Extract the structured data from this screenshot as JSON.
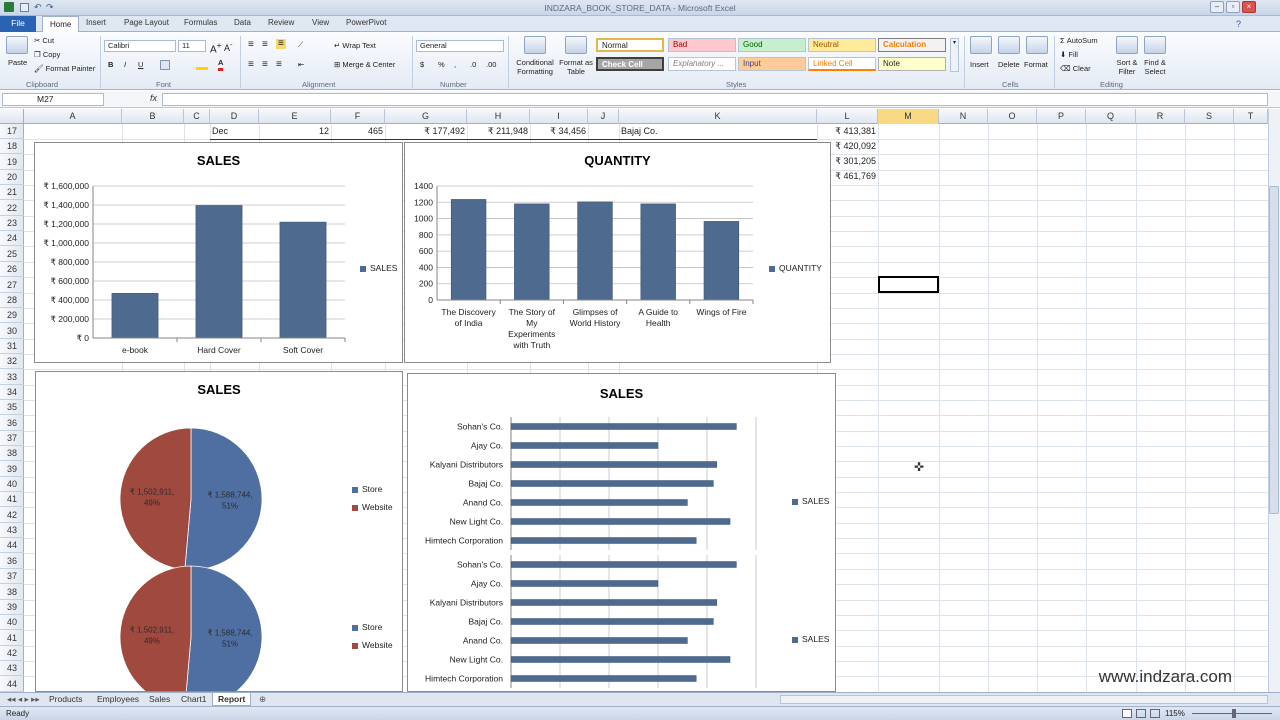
{
  "window": {
    "title": "INDZARA_BOOK_STORE_DATA - Microsoft Excel"
  },
  "tabs": [
    "File",
    "Home",
    "Insert",
    "Page Layout",
    "Formulas",
    "Data",
    "Review",
    "View",
    "PowerPivot"
  ],
  "ribbon": {
    "clipboard": {
      "paste": "Paste",
      "cut": "Cut",
      "copy": "Copy",
      "format_painter": "Format Painter",
      "label": "Clipboard"
    },
    "font": {
      "name": "Calibri",
      "size": "11",
      "bold": "B",
      "italic": "I",
      "underline": "U",
      "label": "Font"
    },
    "alignment": {
      "wrap": "Wrap Text",
      "merge": "Merge & Center",
      "label": "Alignment"
    },
    "number": {
      "format": "General",
      "currency": "$",
      "percent": "%",
      "label": "Number"
    },
    "styles": {
      "conditional": "Conditional Formatting",
      "format_table": "Format as Table",
      "cells": [
        "Normal",
        "Bad",
        "Good",
        "Neutral",
        "Calculation",
        "Check Cell",
        "Explanatory ...",
        "Input",
        "Linked Cell",
        "Note"
      ],
      "label": "Styles"
    },
    "cells": {
      "insert": "Insert",
      "delete": "Delete",
      "format": "Format",
      "label": "Cells"
    },
    "editing": {
      "autosum": "AutoSum",
      "fill": "Fill",
      "clear": "Clear",
      "sort": "Sort & Filter",
      "find": "Find & Select",
      "label": "Editing"
    }
  },
  "formula_bar": {
    "name_box": "M27",
    "fx": "fx",
    "value": ""
  },
  "columns": [
    "A",
    "B",
    "C",
    "D",
    "E",
    "F",
    "G",
    "H",
    "I",
    "J",
    "K",
    "L",
    "M",
    "N",
    "O",
    "P",
    "Q",
    "R",
    "S",
    "T"
  ],
  "row_labels": [
    "17",
    "18",
    "19",
    "20",
    "21",
    "22",
    "23",
    "24",
    "25",
    "26",
    "27",
    "28",
    "29",
    "30",
    "31",
    "32",
    "33",
    "34",
    "35",
    "36",
    "37",
    "38",
    "39",
    "40",
    "41",
    "42",
    "43",
    "44",
    "36",
    "37",
    "38",
    "39",
    "40",
    "41",
    "42",
    "43",
    "44"
  ],
  "grid_cells": {
    "row17": {
      "month": "Dec",
      "e": "12",
      "f": "465",
      "g": "₹ 177,492",
      "h": "₹ 211,948",
      "i": "₹ 34,456",
      "k": "Bajaj Co.",
      "l": "₹ 413,381"
    },
    "l18": "₹ 420,092",
    "l19": "₹ 301,205",
    "l20": "₹ 461,769"
  },
  "chart_data": [
    {
      "type": "bar",
      "title": "SALES",
      "categories": [
        "e-book",
        "Hard Cover",
        "Soft Cover"
      ],
      "series": [
        {
          "name": "SALES",
          "values": [
            470000,
            1395000,
            1220000
          ]
        }
      ],
      "yticks": [
        "₹ 0",
        "₹ 200,000",
        "₹ 400,000",
        "₹ 600,000",
        "₹ 800,000",
        "₹ 1,000,000",
        "₹ 1,200,000",
        "₹ 1,400,000",
        "₹ 1,600,000"
      ],
      "ylim": [
        0,
        1600000
      ],
      "color": "#4f6a8f",
      "grid": true,
      "legend": "right"
    },
    {
      "type": "bar",
      "title": "QUANTITY",
      "categories": [
        "The Discovery of India",
        "The Story of My Experiments with Truth",
        "Glimpses of World History",
        "A Guide to Health",
        "Wings of Fire"
      ],
      "series": [
        {
          "name": "QUANTITY",
          "values": [
            1235,
            1180,
            1205,
            1180,
            965
          ]
        }
      ],
      "yticks": [
        "0",
        "200",
        "400",
        "600",
        "800",
        "1000",
        "1200",
        "1400"
      ],
      "ylim": [
        0,
        1400
      ],
      "color": "#4f6a8f",
      "grid": true,
      "legend": "right"
    },
    {
      "type": "pie",
      "title": "SALES",
      "slices": [
        {
          "name": "Store",
          "value": 1588744,
          "label": "₹ 1,588,744, 51%",
          "color": "#4f6fa3"
        },
        {
          "name": "Website",
          "value": 1502911,
          "label": "₹ 1,502,911, 49%",
          "color": "#a0493f"
        }
      ],
      "legend": "right"
    },
    {
      "type": "bar",
      "orientation": "horizontal",
      "title": "SALES",
      "categories": [
        "Sohan's Co.",
        "Ajay Co.",
        "Kalyani Distributors",
        "Bajaj Co.",
        "Anand Co.",
        "New Light Co.",
        "Himtech Corporation"
      ],
      "series": [
        {
          "name": "SALES",
          "values": [
            460000,
            300000,
            420000,
            413000,
            360000,
            447000,
            378000
          ]
        }
      ],
      "xlim": [
        0,
        500000
      ],
      "color": "#4f6a8f",
      "grid": true,
      "legend": "right"
    }
  ],
  "sheet_tabs": [
    "Products",
    "Employees",
    "Sales",
    "Chart1",
    "Report"
  ],
  "active_sheet": "Report",
  "status": {
    "ready": "Ready",
    "zoom": "115%"
  },
  "watermark": "www.indzara.com",
  "colors": {
    "accent": "#2a63b4",
    "bar": "#4f6a8f",
    "store": "#4f6fa3",
    "website": "#a0493f"
  }
}
